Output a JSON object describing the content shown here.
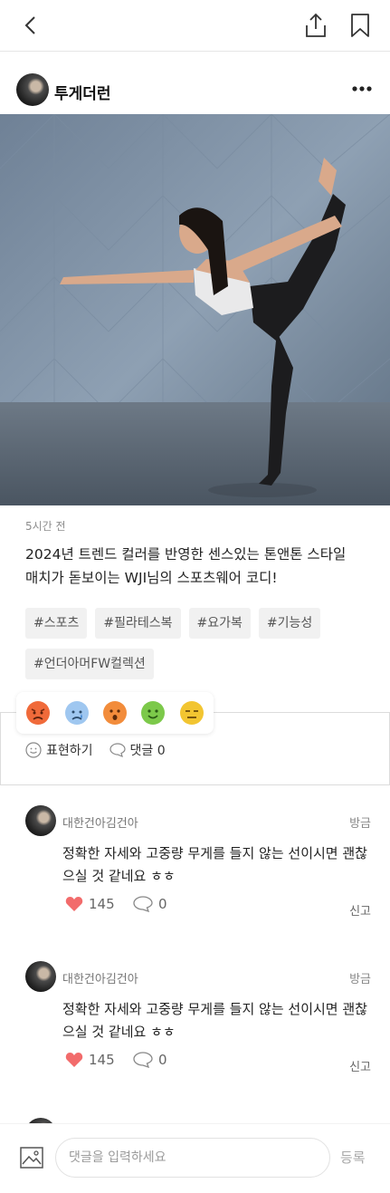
{
  "header": {
    "back_icon": "chevron-left-icon",
    "share_icon": "share-icon",
    "bookmark_icon": "bookmark-icon"
  },
  "post": {
    "author": "투게더런",
    "time": "5시간 전",
    "caption_line1": "2024년 트렌드 컬러를 반영한 센스있는 톤앤톤 스타일",
    "caption_line2": "매치가 돋보이는 WJI님의 스포츠웨어 코디!",
    "tags": [
      "#스포츠",
      "#필라테스복",
      "#요가복",
      "#기능성",
      "#언더아머FW컬렉션"
    ]
  },
  "reactions": {
    "emojis": [
      "angry",
      "sad",
      "surprised",
      "happy",
      "annoyed"
    ],
    "express_label": "표현하기",
    "comment_label": "댓글 0"
  },
  "comments": [
    {
      "name": "대한건아김건아",
      "time": "방금",
      "text": "정확한 자세와 고중량 무게를 들지 않는 선이시면 괜찮으실 것 같네요 ㅎㅎ",
      "likes": "145",
      "replies": "0",
      "report": "신고"
    },
    {
      "name": "대한건아김건아",
      "time": "방금",
      "text": "정확한 자세와 고중량 무게를 들지 않는 선이시면 괜찮으실 것 같네요 ㅎㅎ",
      "likes": "145",
      "replies": "0",
      "report": "신고"
    }
  ],
  "input": {
    "placeholder": "댓글을 입력하세요",
    "submit": "등록"
  },
  "colors": {
    "like": "#f26b6b",
    "muted": "#8d8d8d"
  }
}
